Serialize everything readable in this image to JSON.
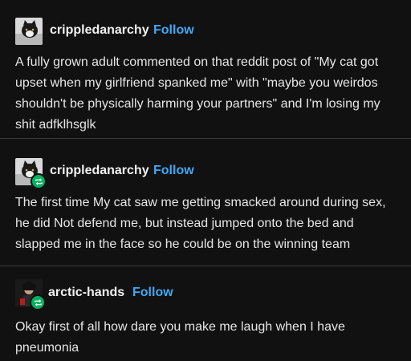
{
  "posts": [
    {
      "author": "crippledanarchy",
      "follow_label": "Follow",
      "reblog": false,
      "text": "A fully grown adult commented on that reddit post of \"My cat got upset when my girlfriend spanked me\" with \"maybe you weirdos shouldn't be physically harming your partners\" and I'm losing my shit adfklhsglk"
    },
    {
      "author": "crippledanarchy",
      "follow_label": "Follow",
      "reblog": true,
      "text": "The first time My cat saw me getting smacked around during sex, he did Not defend me, but instead jumped onto the bed and slapped me in the face so he could be on the winning team"
    },
    {
      "author": "arctic-hands",
      "follow_label": "Follow",
      "reblog": true,
      "text": "Okay first of all how dare you make me laugh when I have pneumonia"
    }
  ],
  "colors": {
    "background": "#111111",
    "follow": "#3fa9f5",
    "reblog_badge": "#00b35d",
    "divider": "#3a3a3a"
  },
  "icons": {
    "avatar_1": "cat-avatar-icon",
    "avatar_2": "cat-avatar-icon",
    "avatar_3": "dark-figure-avatar-icon",
    "reblog": "reblog-icon"
  }
}
